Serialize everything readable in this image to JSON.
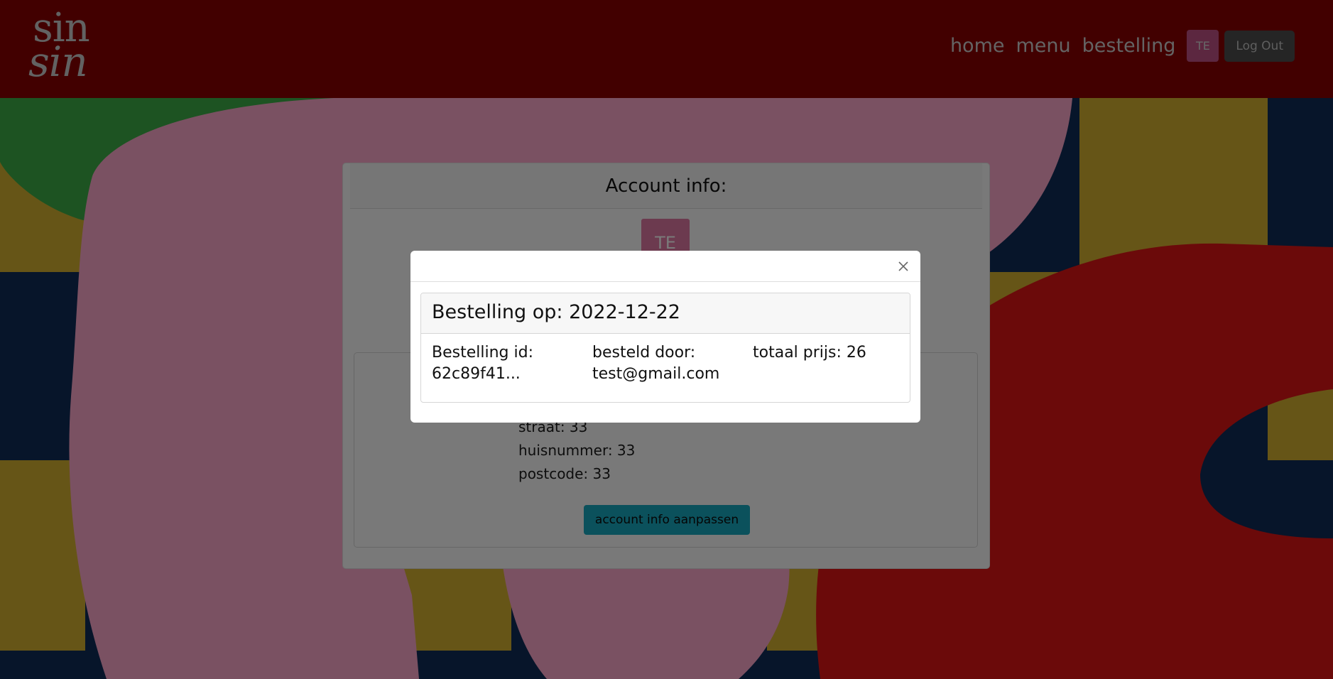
{
  "header": {
    "logo_top": "sin",
    "logo_bottom": "sin",
    "nav": [
      "home",
      "menu",
      "bestelling"
    ],
    "avatar_initials": "TE",
    "logout_label": "Log Out"
  },
  "account_card": {
    "title": "Account info:",
    "avatar_initials": "TE",
    "address_lines": [
      "straat: 33",
      "huisnummer: 33",
      "postcode: 33"
    ],
    "edit_button_label": "account info aanpassen"
  },
  "modal": {
    "order": {
      "header": "Bestelling op: 2022-12-22",
      "id_label": "Bestelling id:",
      "id_value": "62c89f41...",
      "by_label": "besteld door:",
      "by_value": "test@gmail.com",
      "total": "totaal prijs: 26"
    }
  },
  "colors": {
    "header_bg": "#840000",
    "accent_pink": "#d8749f",
    "button_teal": "#17a2b8",
    "art_navy": "#0f2a55",
    "art_mustard": "#ccaa2f",
    "art_green": "#3aa645",
    "art_pink": "#f5a3c5",
    "art_red": "#d71515"
  }
}
